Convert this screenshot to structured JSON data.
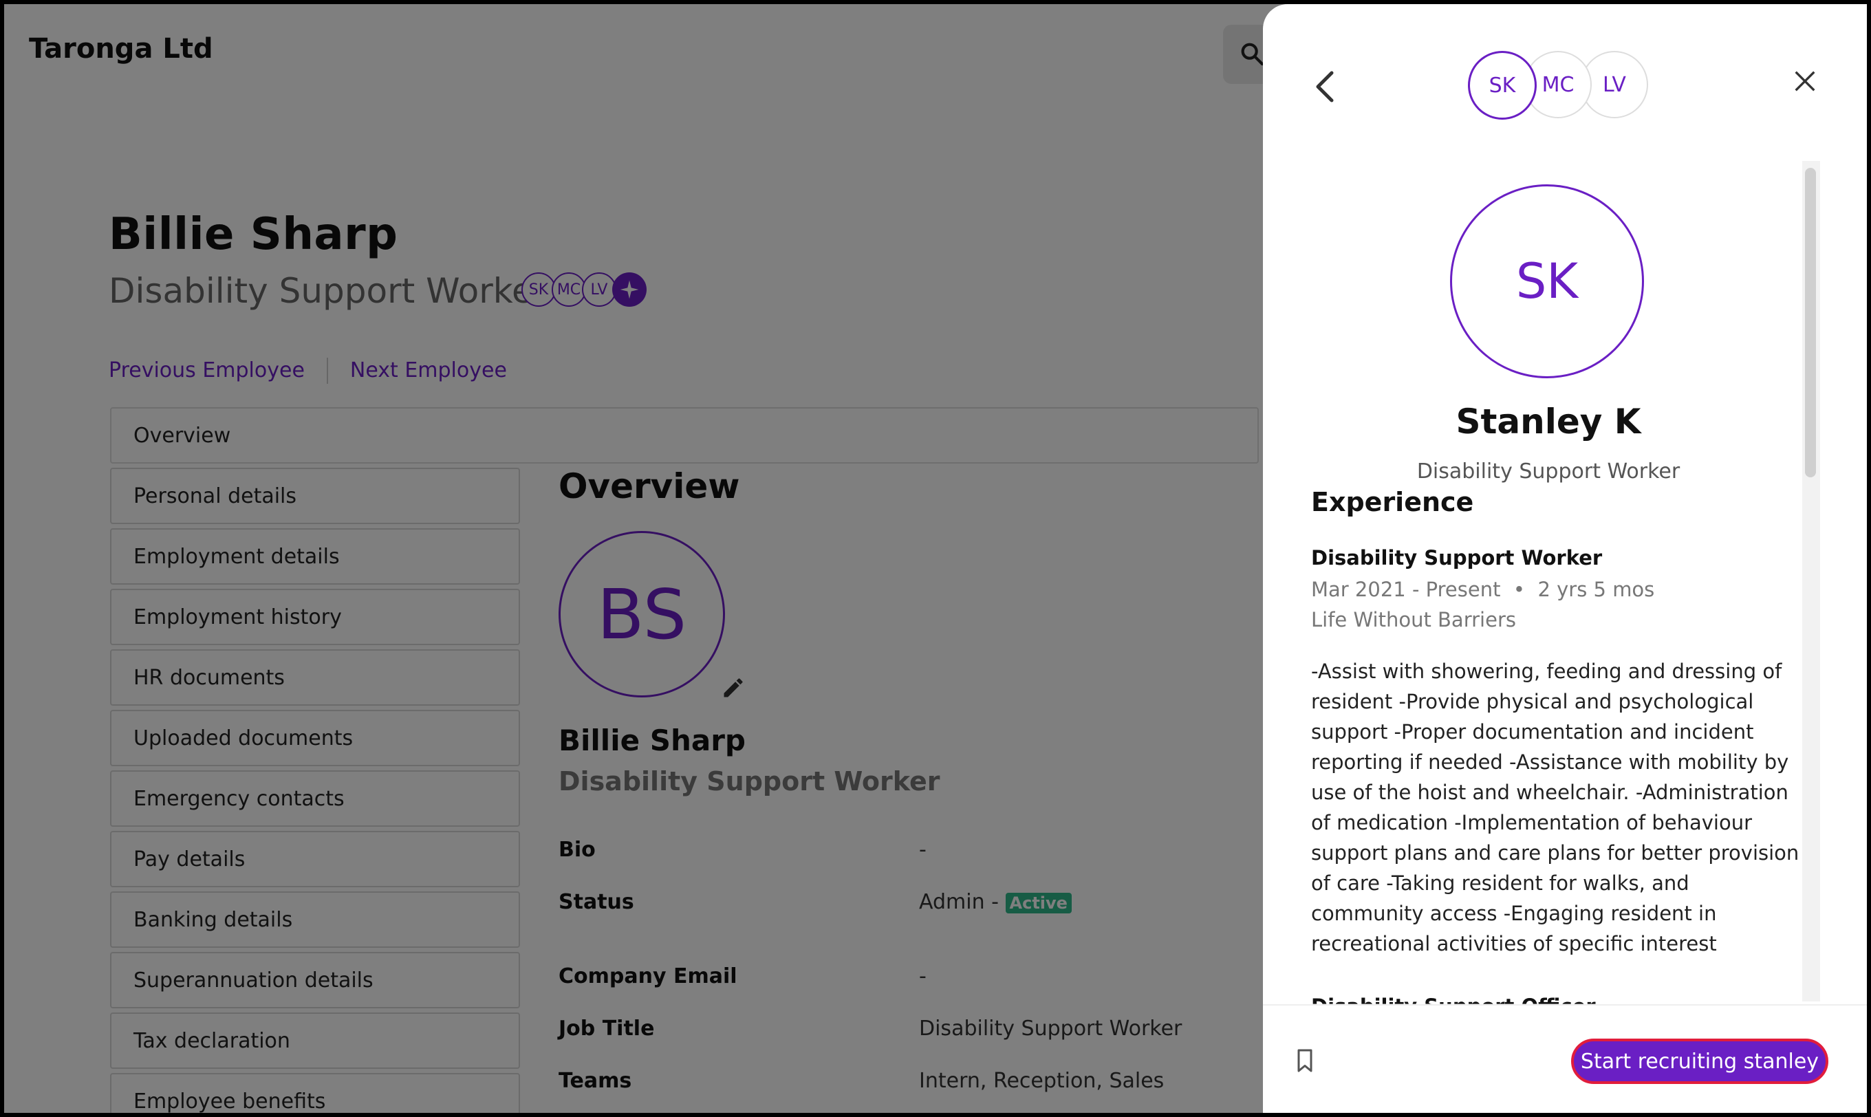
{
  "app": {
    "brand": "Taronga Ltd"
  },
  "header": {
    "name": "Billie Sharp",
    "title": "Disability Support Worker",
    "avatars": [
      "SK",
      "MC",
      "LV"
    ]
  },
  "nav": {
    "previous": "Previous Employee",
    "next": "Next Employee"
  },
  "sidebar": {
    "items": [
      {
        "label": "Overview"
      },
      {
        "label": "Personal details"
      },
      {
        "label": "Employment details"
      },
      {
        "label": "Employment history"
      },
      {
        "label": "HR documents"
      },
      {
        "label": "Uploaded documents"
      },
      {
        "label": "Emergency contacts"
      },
      {
        "label": "Pay details"
      },
      {
        "label": "Banking details"
      },
      {
        "label": "Superannuation details"
      },
      {
        "label": "Tax declaration"
      },
      {
        "label": "Employee benefits"
      }
    ]
  },
  "overview": {
    "title": "Overview",
    "initials": "BS",
    "name": "Billie Sharp",
    "role": "Disability Support Worker",
    "fields": [
      {
        "label": "Bio",
        "value": "-"
      },
      {
        "label": "Status",
        "value": "Admin -",
        "badge": "Active"
      },
      {
        "label": "Company Email",
        "value": "-"
      },
      {
        "label": "Job Title",
        "value": "Disability Support Worker"
      },
      {
        "label": "Teams",
        "value": "Intern, Reception, Sales"
      }
    ]
  },
  "panel": {
    "avatars": [
      "SK",
      "MC",
      "LV"
    ],
    "initials": "SK",
    "name": "Stanley K",
    "role": "Disability Support Worker",
    "experience_title": "Experience",
    "job": {
      "title": "Disability Support Worker",
      "dates": "Mar 2021 - Present",
      "duration": "2 yrs 5 mos",
      "company": "Life Without Barriers",
      "description": "-Assist with showering, feeding and dressing of resident -Provide physical and psychological support -Proper documentation and incident reporting if needed -Assistance with mobility by use of the hoist and wheelchair. -Administration of medication -Implementation of behaviour support plans and care plans for better provision of care -Taking resident for walks, and community access -Engaging resident in recreational activities of specific interest"
    },
    "next_job_partial": "Disability Support Officer",
    "cta": "Start recruiting stanley"
  },
  "colors": {
    "accent": "#6a1fc4",
    "active_badge": "#2eb88a",
    "cta_border": "#e11d3c"
  }
}
